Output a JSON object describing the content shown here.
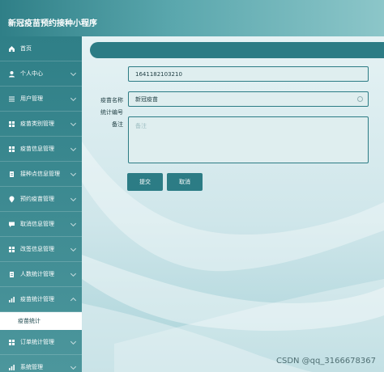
{
  "app": {
    "title": "新冠疫苗预约接种小程序"
  },
  "sidebar": {
    "items": [
      {
        "label": "首页",
        "icon": "home-icon"
      },
      {
        "label": "个人中心",
        "icon": "user-icon"
      },
      {
        "label": "用户管理",
        "icon": "list-icon"
      },
      {
        "label": "疫苗类别管理",
        "icon": "grid-icon"
      },
      {
        "label": "疫苗信息管理",
        "icon": "grid-icon"
      },
      {
        "label": "接种点信息管理",
        "icon": "doc-icon"
      },
      {
        "label": "预约疫苗管理",
        "icon": "pin-icon"
      },
      {
        "label": "取消信息管理",
        "icon": "chat-icon"
      },
      {
        "label": "改签信息管理",
        "icon": "grid-icon"
      },
      {
        "label": "人数统计管理",
        "icon": "doc-icon"
      },
      {
        "label": "疫苗统计管理",
        "icon": "chart-icon"
      }
    ],
    "active_sub": "疫苗统计",
    "items_after": [
      {
        "label": "订单统计管理",
        "icon": "grid-icon"
      },
      {
        "label": "系统管理",
        "icon": "chart-icon"
      }
    ]
  },
  "form": {
    "stat_no_label": "统计编号",
    "stat_no_value": "1641182103210",
    "vaccine_name_label": "疫苗名称",
    "vaccine_name_value": "新冠疫苗",
    "remark_label": "备注",
    "remark_placeholder": "备注",
    "submit_label": "提交",
    "cancel_label": "取消"
  },
  "watermark": "CSDN @qq_3166678367",
  "colors": {
    "accent": "#2c7c85",
    "field_bg": "#dfeeef"
  }
}
